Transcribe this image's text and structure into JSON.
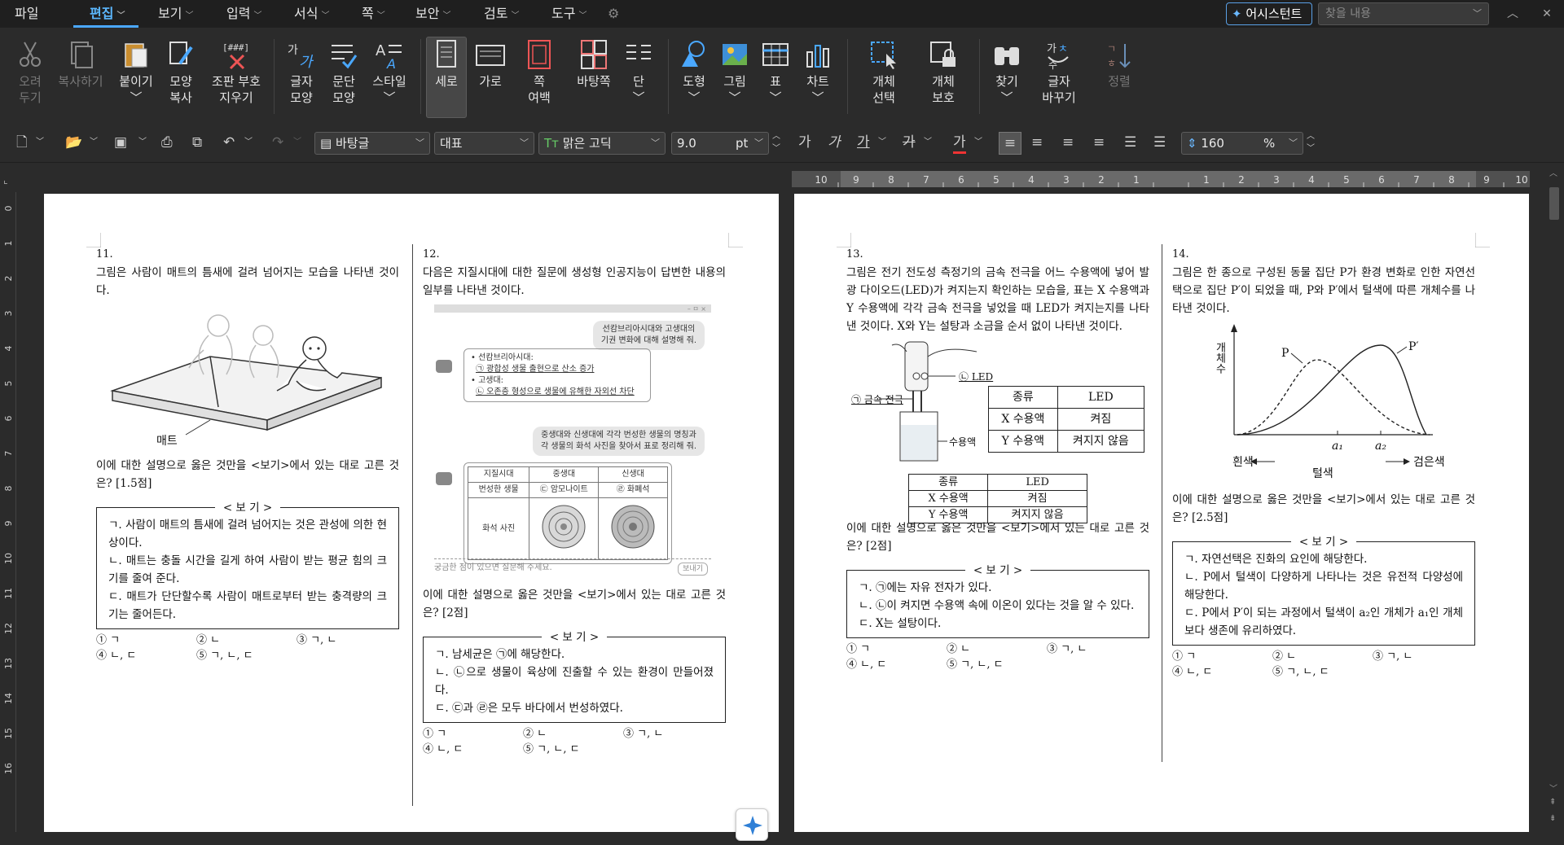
{
  "menubar": {
    "file": "파일",
    "edit": "편집",
    "view": "보기",
    "insert": "입력",
    "format": "서식",
    "page": "쪽",
    "security": "보안",
    "review": "검토",
    "tools": "도구",
    "assistant": "어시스턴트",
    "find_placeholder": "찾을 내용"
  },
  "ribbon": {
    "undo": "오려\n두기",
    "copy": "복사하기",
    "paste": "붙이기",
    "format_copy": "모양\n복사",
    "clear_marks": "조판 부호\n지우기",
    "char_shape": "글자\n모양",
    "para_shape": "문단\n모양",
    "style": "스타일",
    "portrait": "세로",
    "landscape": "가로",
    "page_margin": "쪽\n여백",
    "background": "바탕쪽",
    "columns": "단",
    "shape": "도형",
    "picture": "그림",
    "table": "표",
    "chart": "차트",
    "obj_select": "개체\n선택",
    "obj_protect": "개체\n보호",
    "find": "찾기",
    "replace": "글자\n바꾸기",
    "sort": "정렬"
  },
  "toolbar": {
    "style": "바탕글",
    "rep": "대표",
    "font": "맑은 고딕",
    "font_icon": "Tт",
    "size": "9.0",
    "size_unit": "pt",
    "bold": "가",
    "italic": "가",
    "underline": "가",
    "strike": "가",
    "color": "가",
    "line_spacing": "160",
    "ls_unit": "%"
  },
  "ruler": {
    "labels": [
      "10",
      "9",
      "8",
      "7",
      "6",
      "5",
      "4",
      "3",
      "2",
      "1",
      "",
      "1",
      "2",
      "3",
      "4",
      "5",
      "6",
      "7",
      "8",
      "9",
      "10"
    ],
    "vlabels": [
      "0",
      "1",
      "2",
      "3",
      "4",
      "5",
      "6",
      "7",
      "8",
      "9",
      "10",
      "11",
      "12",
      "13",
      "14",
      "15",
      "16"
    ]
  },
  "q11": {
    "num": "11.",
    "text": "그림은 사람이 매트의 틈새에 걸려 넘어지는 모습을 나타낸 것이다.",
    "fig_label": "매트",
    "question": "이에 대한 설명으로 옳은 것만을 <보기>에서 있는 대로 고른 것은? [1.5점]",
    "bogi_title": "< 보 기 >",
    "items": [
      "ㄱ. 사람이 매트의 틈새에 걸려 넘어지는 것은 관성에 의한 현상이다.",
      "ㄴ. 매트는 충돌 시간을 길게 하여 사람이 받는 평균 힘의 크기를 줄여 준다.",
      "ㄷ. 매트가 단단할수록 사람이 매트로부터 받는 충격량의 크기는 줄어든다."
    ],
    "choices": [
      "① ㄱ",
      "② ㄴ",
      "③ ㄱ, ㄴ",
      "④ ㄴ, ㄷ",
      "⑤ ㄱ, ㄴ, ㄷ",
      ""
    ]
  },
  "q12": {
    "num": "12.",
    "text": "다음은 지질시대에 대한 질문에 생성형 인공지능이 답변한 내용의 일부를 나타낸 것이다.",
    "chat_win": "– ㅁ ×",
    "bubble1_l1": "선캄브리아시대와 고생대의",
    "bubble1_l2": "기권 변화에 대해 설명해 줘.",
    "ans1_a": "• 선캄브리아시대:",
    "ans1_b": "㉠ 광합성 생물 출현으로 산소 증가",
    "ans1_c": "• 고생대:",
    "ans1_d": "㉡ 오존층 형성으로 생물에 유해한 자외선 차단",
    "bubble2_l1": "중생대와 신생대에 각각 번성한 생물의 명칭과",
    "bubble2_l2": "각 생물의 화석 사진을 찾아서 표로 정리해 줘.",
    "tbl_h1": "지질시대",
    "tbl_h2": "중생대",
    "tbl_h3": "신생대",
    "tbl_r1": "번성한 생물",
    "tbl_r1c2": "㉢ 암모나이트",
    "tbl_r1c3": "㉣ 화폐석",
    "tbl_r2": "화석 사진",
    "input_ph": "궁금한 점이 있으면 질문해 주세요.",
    "send": "보내기",
    "question": "이에 대한 설명으로 옳은 것만을 <보기>에서 있는 대로 고른 것은? [2점]",
    "bogi_title": "< 보 기 >",
    "items": [
      "ㄱ. 남세균은 ㉠에 해당한다.",
      "ㄴ. ㉡으로 생물이 육상에 진출할 수 있는 환경이 만들어졌다.",
      "ㄷ. ㉢과 ㉣은 모두 바다에서 번성하였다."
    ],
    "choices": [
      "① ㄱ",
      "② ㄴ",
      "③ ㄱ, ㄴ",
      "④ ㄴ, ㄷ",
      "⑤ ㄱ, ㄴ, ㄷ",
      ""
    ]
  },
  "q13": {
    "num": "13.",
    "text": "그림은 전기 전도성 측정기의 금속 전극을 어느 수용액에 넣어 발광 다이오드(LED)가 켜지는지 확인하는 모습을, 표는 X 수용액과 Y 수용액에 각각 금속 전극을 넣었을 때 LED가 켜지는지를 나타낸 것이다. X와 Y는 설탕과 소금을 순서 없이 나타낸 것이다.",
    "fig_led": "㉡ LED",
    "fig_elec": "㉠ 금속 전극",
    "fig_sol": "수용액",
    "tbl_h1": "종류",
    "tbl_h2": "LED",
    "tbl_r1c1": "X 수용액",
    "tbl_r1c2": "켜짐",
    "tbl_r2c1": "Y 수용액",
    "tbl_r2c2": "켜지지 않음",
    "question": "이에 대한 설명으로 옳은 것만을 <보기>에서 있는 대로 고른 것은? [2점]",
    "bogi_title": "< 보 기 >",
    "items": [
      "ㄱ. ㉠에는 자유 전자가 있다.",
      "ㄴ. ㉡이 켜지면 수용액 속에 이온이 있다는 것을 알 수 있다.",
      "ㄷ. X는 설탕이다."
    ],
    "choices": [
      "① ㄱ",
      "② ㄴ",
      "③ ㄱ, ㄴ",
      "④ ㄴ, ㄷ",
      "⑤ ㄱ, ㄴ, ㄷ",
      ""
    ]
  },
  "q14": {
    "num": "14.",
    "text": "그림은 한 종으로 구성된 동물 집단 P가 환경 변화로 인한 자연선택으로 집단 P′이 되었을 때, P와 P′에서 털색에 따른 개체수를 나타낸 것이다.",
    "y_label": "개체수",
    "p": "P",
    "p2": "P′",
    "a1": "a₁",
    "a2": "a₂",
    "white": "흰색",
    "fur": "털색",
    "black": "검은색",
    "question": "이에 대한 설명으로 옳은 것만을 <보기>에서 있는 대로 고른 것은? [2.5점]",
    "bogi_title": "< 보 기 >",
    "items": [
      "ㄱ. 자연선택은 진화의 요인에 해당한다.",
      "ㄴ. P에서 털색이 다양하게 나타나는 것은 유전적 다양성에 해당한다.",
      "ㄷ. P에서 P′이 되는 과정에서 털색이 a₂인 개체가 a₁인 개체보다 생존에 유리하였다."
    ],
    "choices": [
      "① ㄱ",
      "② ㄴ",
      "③ ㄱ, ㄴ",
      "④ ㄴ, ㄷ",
      "⑤ ㄱ, ㄴ, ㄷ",
      ""
    ]
  }
}
